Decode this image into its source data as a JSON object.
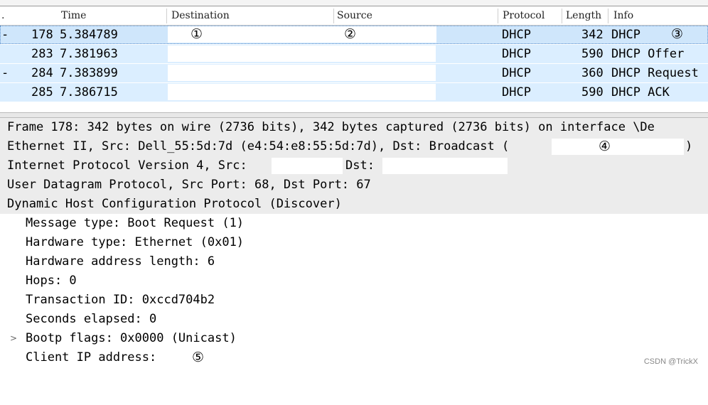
{
  "columns": {
    "time": "Time",
    "destination": "Destination",
    "source": "Source",
    "protocol": "Protocol",
    "length": "Length",
    "info": "Info"
  },
  "packets": [
    {
      "no": "178",
      "time": "5.384789",
      "protocol": "DHCP",
      "length": "342",
      "info": "DHCP",
      "dest_marker": "①",
      "src_marker": "②",
      "info_marker": "③"
    },
    {
      "no": "283",
      "time": "7.381963",
      "protocol": "DHCP",
      "length": "590",
      "info": "DHCP Offer"
    },
    {
      "no": "284",
      "time": "7.383899",
      "protocol": "DHCP",
      "length": "360",
      "info": "DHCP Request"
    },
    {
      "no": "285",
      "time": "7.386715",
      "protocol": "DHCP",
      "length": "590",
      "info": "DHCP ACK"
    }
  ],
  "details": {
    "frame": "Frame 178: 342 bytes on wire (2736 bits), 342 bytes captured (2736 bits) on interface \\De",
    "ethernet": "Ethernet II, Src: Dell_55:5d:7d (e4:54:e8:55:5d:7d), Dst: Broadcast (",
    "ethernet_marker": "④",
    "ethernet_close": ")",
    "ip_prefix": "Internet Protocol Version 4, Src:",
    "ip_dst": "Dst:",
    "udp": "User Datagram Protocol, Src Port: 68, Dst Port: 67",
    "dhcp": "Dynamic Host Configuration Protocol (Discover)",
    "message_type": "Message type: Boot Request (1)",
    "hardware_type": "Hardware type: Ethernet (0x01)",
    "hardware_length": "Hardware address length: 6",
    "hops": "Hops: 0",
    "transaction_id": "Transaction ID: 0xccd704b2",
    "seconds": "Seconds elapsed: 0",
    "bootp_flags": "Bootp flags: 0x0000 (Unicast)",
    "client_ip": "Client IP address:",
    "client_ip_marker": "⑤"
  },
  "watermark": "CSDN @TrickX"
}
